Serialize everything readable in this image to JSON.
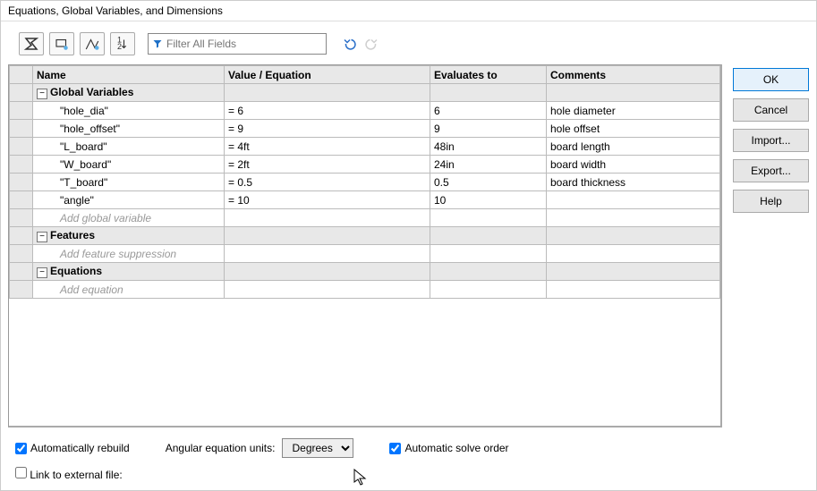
{
  "window": {
    "title": "Equations, Global Variables, and Dimensions"
  },
  "toolbar": {
    "filter_placeholder": "Filter All Fields"
  },
  "columns": {
    "name": "Name",
    "value": "Value / Equation",
    "evaluates": "Evaluates to",
    "comments": "Comments"
  },
  "sections": {
    "global_variables": "Global Variables",
    "features": "Features",
    "equations": "Equations"
  },
  "placeholders": {
    "add_global": "Add global variable",
    "add_feature": "Add feature suppression",
    "add_equation": "Add equation"
  },
  "global_variables": [
    {
      "name": "\"hole_dia\"",
      "value": "= 6",
      "evaluates": "6",
      "comments": "hole diameter"
    },
    {
      "name": "\"hole_offset\"",
      "value": "= 9",
      "evaluates": "9",
      "comments": "hole offset"
    },
    {
      "name": "\"L_board\"",
      "value": "= 4ft",
      "evaluates": "48in",
      "comments": "board length"
    },
    {
      "name": "\"W_board\"",
      "value": "= 2ft",
      "evaluates": "24in",
      "comments": "board width"
    },
    {
      "name": "\"T_board\"",
      "value": "= 0.5",
      "evaluates": "0.5",
      "comments": "board thickness"
    },
    {
      "name": "\"angle\"",
      "value": "= 10",
      "evaluates": "10",
      "comments": ""
    }
  ],
  "bottom": {
    "auto_rebuild": "Automatically rebuild",
    "angular_units_label": "Angular equation units:",
    "angular_units": "Degrees",
    "auto_solve": "Automatic solve order",
    "link_external": "Link to external file:"
  },
  "buttons": {
    "ok": "OK",
    "cancel": "Cancel",
    "import": "Import...",
    "export": "Export...",
    "help": "Help"
  }
}
